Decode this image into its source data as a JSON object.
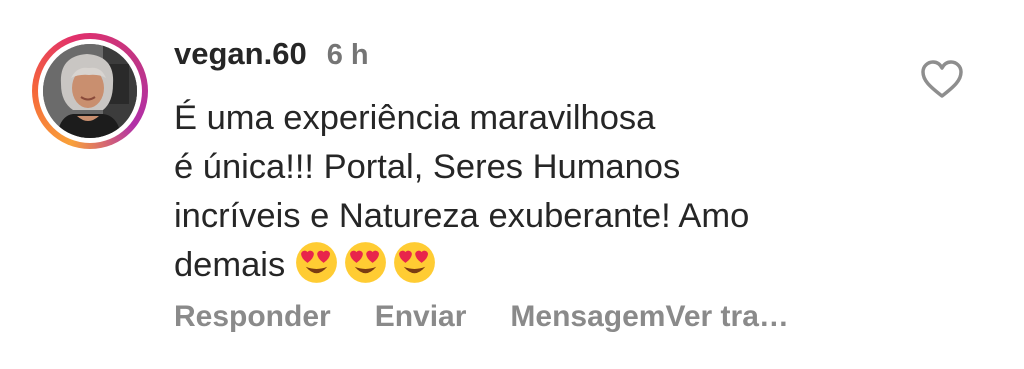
{
  "comment": {
    "username": "vegan.60",
    "time": "6 h",
    "lines": [
      "É uma experiência maravilhosa",
      "é única!!! Portal, Seres Humanos",
      "incríveis e Natureza exuberante! Amo",
      "demais"
    ],
    "emojis": [
      "heart-eyes-emoji",
      "heart-eyes-emoji",
      "heart-eyes-emoji"
    ]
  },
  "actions": {
    "reply": "Responder",
    "send": "Enviar",
    "message": "Mensagem",
    "translate": "Ver tra…"
  },
  "icons": {
    "like": "heart-outline-icon"
  },
  "colors": {
    "text": "#262626",
    "secondary": "#757575",
    "action": "#8a8a8a",
    "ring_start": "#f9a13a",
    "ring_end": "#c13584"
  }
}
